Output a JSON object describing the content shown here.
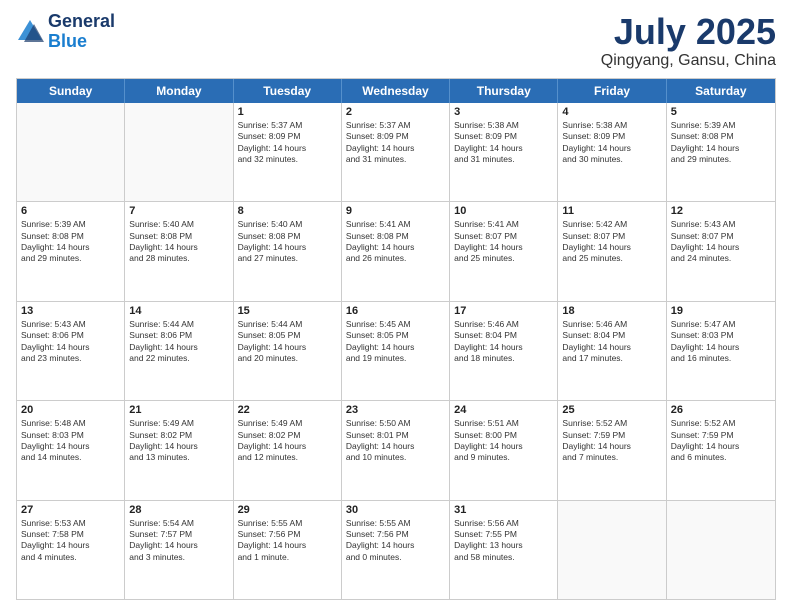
{
  "header": {
    "logo_general": "General",
    "logo_blue": "Blue",
    "month_title": "July 2025",
    "location": "Qingyang, Gansu, China"
  },
  "weekdays": [
    "Sunday",
    "Monday",
    "Tuesday",
    "Wednesday",
    "Thursday",
    "Friday",
    "Saturday"
  ],
  "rows": [
    [
      {
        "day": "",
        "info": ""
      },
      {
        "day": "",
        "info": ""
      },
      {
        "day": "1",
        "info": "Sunrise: 5:37 AM\nSunset: 8:09 PM\nDaylight: 14 hours\nand 32 minutes."
      },
      {
        "day": "2",
        "info": "Sunrise: 5:37 AM\nSunset: 8:09 PM\nDaylight: 14 hours\nand 31 minutes."
      },
      {
        "day": "3",
        "info": "Sunrise: 5:38 AM\nSunset: 8:09 PM\nDaylight: 14 hours\nand 31 minutes."
      },
      {
        "day": "4",
        "info": "Sunrise: 5:38 AM\nSunset: 8:09 PM\nDaylight: 14 hours\nand 30 minutes."
      },
      {
        "day": "5",
        "info": "Sunrise: 5:39 AM\nSunset: 8:08 PM\nDaylight: 14 hours\nand 29 minutes."
      }
    ],
    [
      {
        "day": "6",
        "info": "Sunrise: 5:39 AM\nSunset: 8:08 PM\nDaylight: 14 hours\nand 29 minutes."
      },
      {
        "day": "7",
        "info": "Sunrise: 5:40 AM\nSunset: 8:08 PM\nDaylight: 14 hours\nand 28 minutes."
      },
      {
        "day": "8",
        "info": "Sunrise: 5:40 AM\nSunset: 8:08 PM\nDaylight: 14 hours\nand 27 minutes."
      },
      {
        "day": "9",
        "info": "Sunrise: 5:41 AM\nSunset: 8:08 PM\nDaylight: 14 hours\nand 26 minutes."
      },
      {
        "day": "10",
        "info": "Sunrise: 5:41 AM\nSunset: 8:07 PM\nDaylight: 14 hours\nand 25 minutes."
      },
      {
        "day": "11",
        "info": "Sunrise: 5:42 AM\nSunset: 8:07 PM\nDaylight: 14 hours\nand 25 minutes."
      },
      {
        "day": "12",
        "info": "Sunrise: 5:43 AM\nSunset: 8:07 PM\nDaylight: 14 hours\nand 24 minutes."
      }
    ],
    [
      {
        "day": "13",
        "info": "Sunrise: 5:43 AM\nSunset: 8:06 PM\nDaylight: 14 hours\nand 23 minutes."
      },
      {
        "day": "14",
        "info": "Sunrise: 5:44 AM\nSunset: 8:06 PM\nDaylight: 14 hours\nand 22 minutes."
      },
      {
        "day": "15",
        "info": "Sunrise: 5:44 AM\nSunset: 8:05 PM\nDaylight: 14 hours\nand 20 minutes."
      },
      {
        "day": "16",
        "info": "Sunrise: 5:45 AM\nSunset: 8:05 PM\nDaylight: 14 hours\nand 19 minutes."
      },
      {
        "day": "17",
        "info": "Sunrise: 5:46 AM\nSunset: 8:04 PM\nDaylight: 14 hours\nand 18 minutes."
      },
      {
        "day": "18",
        "info": "Sunrise: 5:46 AM\nSunset: 8:04 PM\nDaylight: 14 hours\nand 17 minutes."
      },
      {
        "day": "19",
        "info": "Sunrise: 5:47 AM\nSunset: 8:03 PM\nDaylight: 14 hours\nand 16 minutes."
      }
    ],
    [
      {
        "day": "20",
        "info": "Sunrise: 5:48 AM\nSunset: 8:03 PM\nDaylight: 14 hours\nand 14 minutes."
      },
      {
        "day": "21",
        "info": "Sunrise: 5:49 AM\nSunset: 8:02 PM\nDaylight: 14 hours\nand 13 minutes."
      },
      {
        "day": "22",
        "info": "Sunrise: 5:49 AM\nSunset: 8:02 PM\nDaylight: 14 hours\nand 12 minutes."
      },
      {
        "day": "23",
        "info": "Sunrise: 5:50 AM\nSunset: 8:01 PM\nDaylight: 14 hours\nand 10 minutes."
      },
      {
        "day": "24",
        "info": "Sunrise: 5:51 AM\nSunset: 8:00 PM\nDaylight: 14 hours\nand 9 minutes."
      },
      {
        "day": "25",
        "info": "Sunrise: 5:52 AM\nSunset: 7:59 PM\nDaylight: 14 hours\nand 7 minutes."
      },
      {
        "day": "26",
        "info": "Sunrise: 5:52 AM\nSunset: 7:59 PM\nDaylight: 14 hours\nand 6 minutes."
      }
    ],
    [
      {
        "day": "27",
        "info": "Sunrise: 5:53 AM\nSunset: 7:58 PM\nDaylight: 14 hours\nand 4 minutes."
      },
      {
        "day": "28",
        "info": "Sunrise: 5:54 AM\nSunset: 7:57 PM\nDaylight: 14 hours\nand 3 minutes."
      },
      {
        "day": "29",
        "info": "Sunrise: 5:55 AM\nSunset: 7:56 PM\nDaylight: 14 hours\nand 1 minute."
      },
      {
        "day": "30",
        "info": "Sunrise: 5:55 AM\nSunset: 7:56 PM\nDaylight: 14 hours\nand 0 minutes."
      },
      {
        "day": "31",
        "info": "Sunrise: 5:56 AM\nSunset: 7:55 PM\nDaylight: 13 hours\nand 58 minutes."
      },
      {
        "day": "",
        "info": ""
      },
      {
        "day": "",
        "info": ""
      }
    ]
  ]
}
